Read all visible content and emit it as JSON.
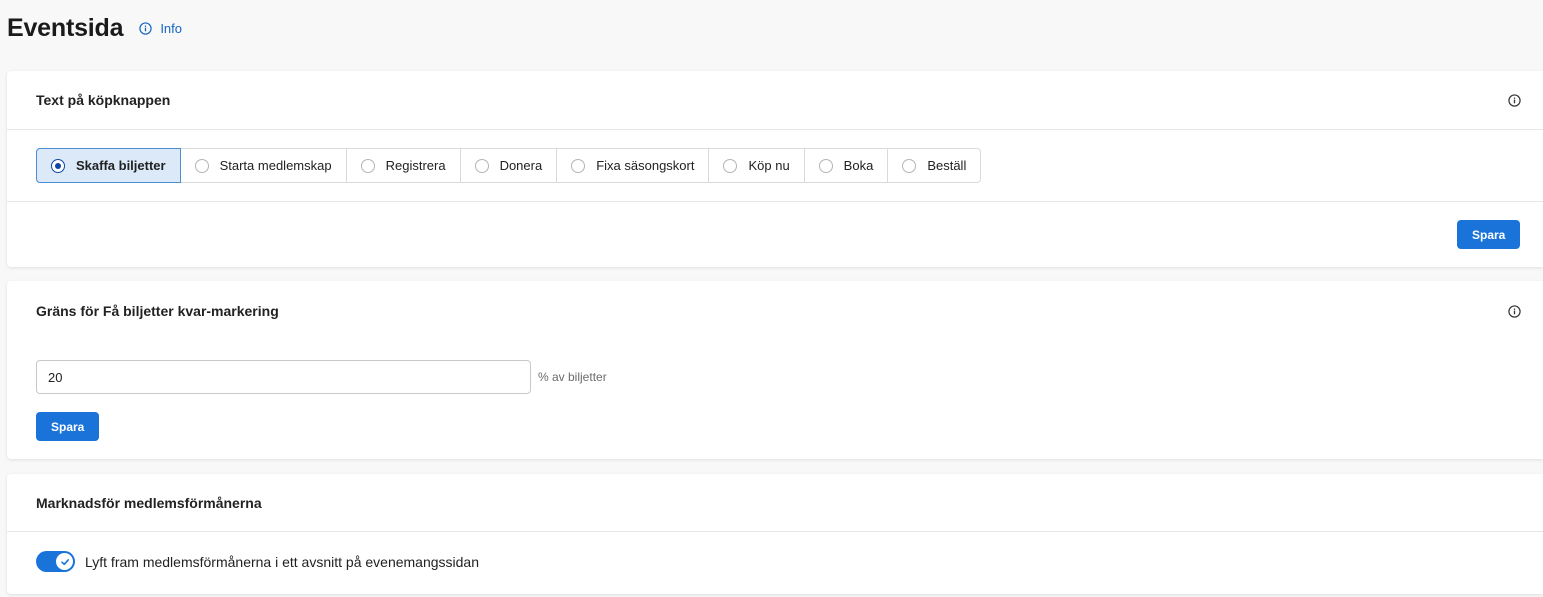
{
  "page": {
    "title": "Eventsida",
    "info_link": "Info"
  },
  "buy_button_card": {
    "title": "Text på köpknappen",
    "options": [
      {
        "label": "Skaffa biljetter",
        "selected": true
      },
      {
        "label": "Starta medlemskap",
        "selected": false
      },
      {
        "label": "Registrera",
        "selected": false
      },
      {
        "label": "Donera",
        "selected": false
      },
      {
        "label": "Fixa säsongskort",
        "selected": false
      },
      {
        "label": "Köp nu",
        "selected": false
      },
      {
        "label": "Boka",
        "selected": false
      },
      {
        "label": "Beställ",
        "selected": false
      }
    ],
    "save_label": "Spara"
  },
  "few_tickets_card": {
    "title": "Gräns för Få biljetter kvar-markering",
    "input_value": "20",
    "input_suffix": "% av biljetter",
    "save_label": "Spara"
  },
  "marketing_card": {
    "title": "Marknadsför medlemsförmånerna",
    "toggle_label": "Lyft fram medlemsförmånerna i ett avsnitt på evenemangssidan",
    "toggle_on": true
  },
  "colors": {
    "accent": "#1a73d9",
    "selected_bg": "#dbe9f8",
    "link": "#1565c0"
  }
}
